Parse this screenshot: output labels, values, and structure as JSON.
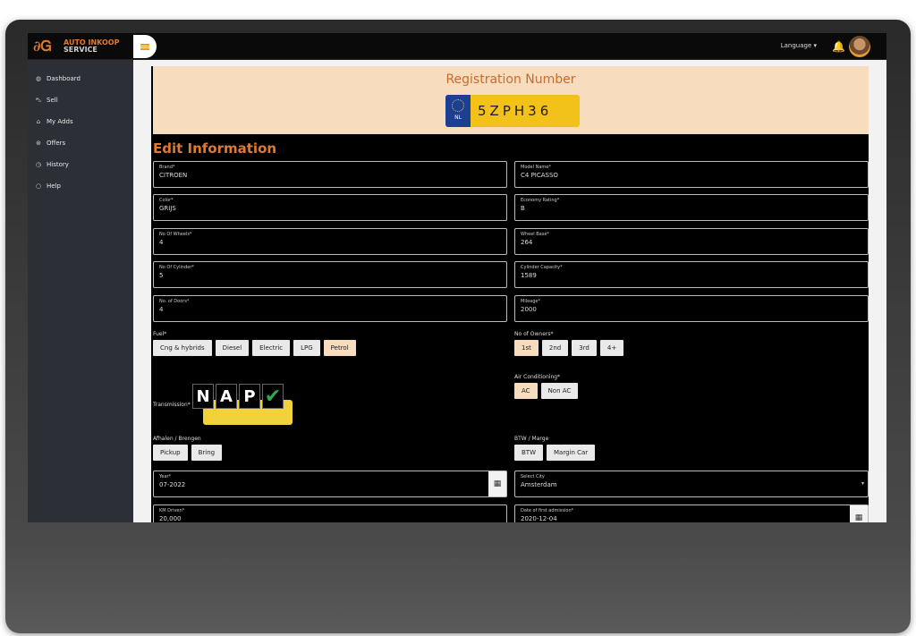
{
  "app": {
    "logo_line1": "AUTO INKOOP",
    "logo_line2": "SERVICE",
    "language_label": "Language",
    "colors": {
      "accent": "#e07a2f",
      "panel": "#f8dcbe",
      "plate_yellow": "#f2c21a",
      "plate_blue": "#1d3f91"
    }
  },
  "sidebar": {
    "items": [
      {
        "label": "Dashboard",
        "icon": "dashboard-icon"
      },
      {
        "label": "Sell",
        "icon": "car-icon"
      },
      {
        "label": "My Adds",
        "icon": "home-icon"
      },
      {
        "label": "Offers",
        "icon": "offers-icon"
      },
      {
        "label": "History",
        "icon": "history-icon"
      },
      {
        "label": "Help",
        "icon": "help-icon"
      }
    ]
  },
  "registration": {
    "title": "Registration Number",
    "country": "NL",
    "plate": "5ZPH36"
  },
  "edit": {
    "title": "Edit Information",
    "fields": {
      "brand": {
        "label": "Brand*",
        "value": "CITROEN"
      },
      "model": {
        "label": "Model Name*",
        "value": "C4 PICASSO"
      },
      "color": {
        "label": "Color*",
        "value": "GRIJS"
      },
      "economy": {
        "label": "Economy Rating*",
        "value": "B"
      },
      "wheels": {
        "label": "No Of Wheels*",
        "value": "4"
      },
      "wheelbase": {
        "label": "Wheel Base*",
        "value": "264"
      },
      "cylinders": {
        "label": "No Of Cylinder*",
        "value": "5"
      },
      "cyl_capacity": {
        "label": "Cylinder Capacity*",
        "value": "1589"
      },
      "doors": {
        "label": "No. of Doors*",
        "value": "4"
      },
      "mileage": {
        "label": "Mileage*",
        "value": "2000"
      },
      "year": {
        "label": "Year*",
        "value": "07-2022"
      },
      "city": {
        "label": "Select City",
        "value": "Amsterdam"
      },
      "km_driven": {
        "label": "KM Driven*",
        "value": "20,000"
      },
      "first_admission": {
        "label": "Date of first admission*",
        "value": "2020-12-04"
      }
    },
    "fuel": {
      "label": "Fuel*",
      "options": [
        "Cng & hybrids",
        "Diesel",
        "Electric",
        "LPG",
        "Petrol"
      ],
      "selected": "Petrol"
    },
    "owners": {
      "label": "No of Owners*",
      "options": [
        "1st",
        "2nd",
        "3rd",
        "4+"
      ],
      "selected": "1st"
    },
    "transmission": {
      "label": "Transmission*"
    },
    "nap": {
      "letters": [
        "N",
        "A",
        "P"
      ]
    },
    "ac": {
      "label": "Air Conditioning*",
      "options": [
        "AC",
        "Non AC"
      ],
      "selected": "AC"
    },
    "pickup": {
      "label": "Afhalen / Brengen",
      "options": [
        "Pickup",
        "Bring"
      ]
    },
    "btw": {
      "label": "BTW / Marge",
      "options": [
        "BTW",
        "Margin Car"
      ]
    }
  }
}
